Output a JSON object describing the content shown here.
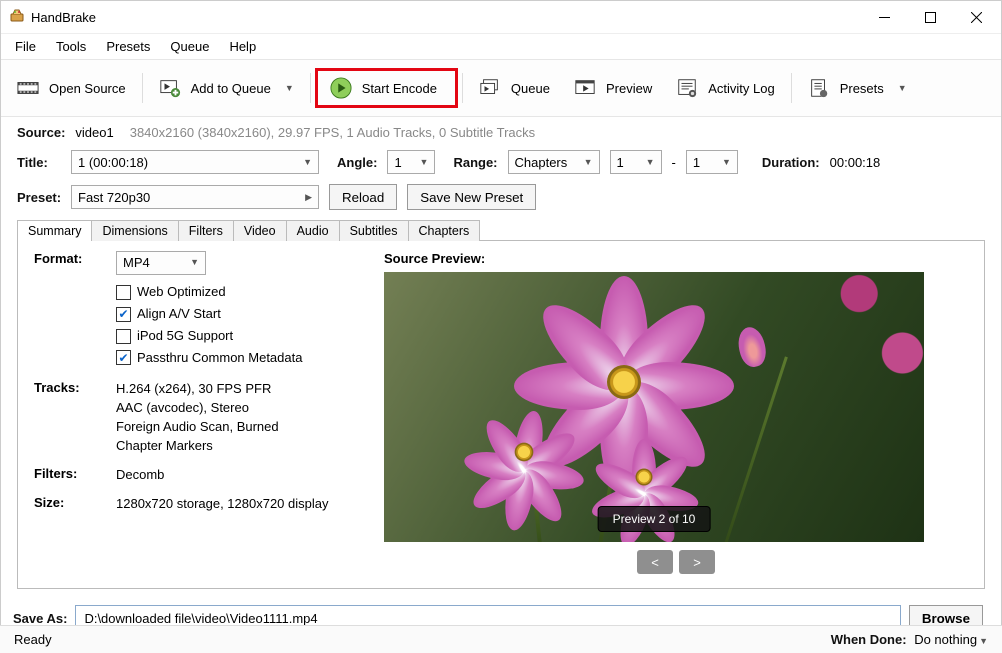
{
  "window": {
    "title": "HandBrake"
  },
  "menus": [
    "File",
    "Tools",
    "Presets",
    "Queue",
    "Help"
  ],
  "toolbar": {
    "open_source": "Open Source",
    "add_queue": "Add to Queue",
    "start_encode": "Start Encode",
    "queue": "Queue",
    "preview": "Preview",
    "activity_log": "Activity Log",
    "presets": "Presets"
  },
  "source": {
    "label": "Source:",
    "name": "video1",
    "info": "3840x2160 (3840x2160), 29.97 FPS, 1 Audio Tracks, 0 Subtitle Tracks"
  },
  "title_row": {
    "title_label": "Title:",
    "title_value": "1  (00:00:18)",
    "angle_label": "Angle:",
    "angle_value": "1",
    "range_label": "Range:",
    "range_type": "Chapters",
    "range_from": "1",
    "range_sep": "-",
    "range_to": "1",
    "duration_label": "Duration:",
    "duration_value": "00:00:18"
  },
  "preset_row": {
    "label": "Preset:",
    "value": "Fast 720p30",
    "reload": "Reload",
    "save_new": "Save New Preset"
  },
  "tabs": [
    "Summary",
    "Dimensions",
    "Filters",
    "Video",
    "Audio",
    "Subtitles",
    "Chapters"
  ],
  "summary": {
    "format_label": "Format:",
    "format_value": "MP4",
    "cb_web": "Web Optimized",
    "cb_av": "Align A/V Start",
    "cb_ipod": "iPod 5G Support",
    "cb_meta": "Passthru Common Metadata",
    "tracks_label": "Tracks:",
    "tracks_lines": [
      "H.264 (x264), 30 FPS PFR",
      "AAC (avcodec), Stereo",
      "Foreign Audio Scan, Burned",
      "Chapter Markers"
    ],
    "filters_label": "Filters:",
    "filters_value": "Decomb",
    "size_label": "Size:",
    "size_value": "1280x720 storage, 1280x720 display"
  },
  "preview": {
    "title": "Source Preview:",
    "badge": "Preview 2 of 10",
    "prev": "<",
    "next": ">"
  },
  "save": {
    "label": "Save As:",
    "value": "D:\\downloaded file\\video\\Video1111.mp4",
    "browse": "Browse"
  },
  "status": {
    "ready": "Ready",
    "when_done_label": "When Done:",
    "when_done_value": "Do nothing"
  }
}
